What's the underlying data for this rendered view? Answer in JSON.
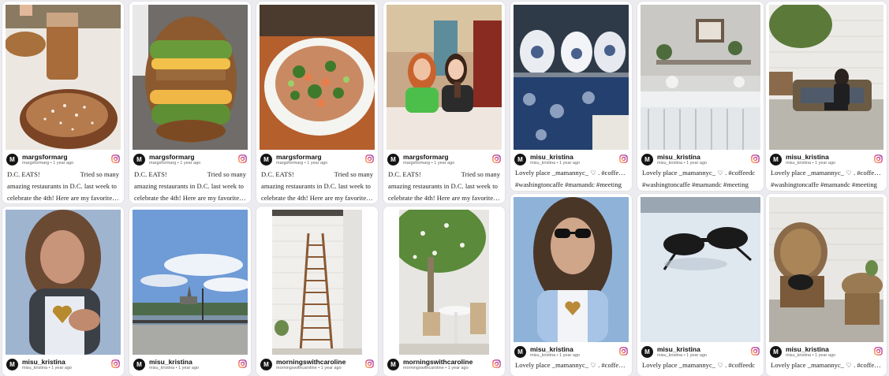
{
  "avatar_letter": "M",
  "time_ago": "1 year ago",
  "bullet": "•",
  "icons": {
    "brand": "instagram-icon",
    "avatar": "avatar-m-icon",
    "heart": "heart-icon"
  },
  "colors": {
    "instagram_gradient": [
      "#f9a23a",
      "#e1306c",
      "#833ab4"
    ],
    "avatar_bg": "#141414",
    "page_bg": "#ececf0"
  },
  "posts": [
    {
      "user": "margsformarg",
      "handle": "margsformarg",
      "caption_head": "D.C. EATS!",
      "caption_right": "Tried so many",
      "caption_line2": "amazing restaurants in D.C. last week to",
      "caption_line3": "celebrate the 4th! Here are my favorite thin..."
    },
    {
      "user": "margsformarg",
      "handle": "margsformarg",
      "caption_head": "D.C. EATS!",
      "caption_right": "Tried so many",
      "caption_line2": "amazing restaurants in D.C. last week to",
      "caption_line3": "celebrate the 4th! Here are my favorite thin..."
    },
    {
      "user": "margsformarg",
      "handle": "margsformarg",
      "caption_head": "D.C. EATS!",
      "caption_right": "Tried so many",
      "caption_line2": "amazing restaurants in D.C. last week to",
      "caption_line3": "celebrate the 4th! Here are my favorite thin..."
    },
    {
      "user": "margsformarg",
      "handle": "margsformarg",
      "caption_head": "D.C. EATS!",
      "caption_right": "Tried so many",
      "caption_line2": "amazing restaurants in D.C. last week to",
      "caption_line3": "celebrate the 4th! Here are my favorite thin..."
    },
    {
      "user": "misu_kristina",
      "handle": "misu_kristina",
      "caption_head": "Lovely place _mamannyc_ ♡ . #coffeedc",
      "caption_line2": "#washingtoncaffe #mamandc #meeting"
    },
    {
      "user": "misu_kristina",
      "handle": "misu_kristina",
      "caption_head": "Lovely place _mamannyc_ ♡ . #coffeedc",
      "caption_line2": "#washingtoncaffe #mamandc #meeting"
    },
    {
      "user": "misu_kristina",
      "handle": "misu_kristina",
      "caption_head": "Lovely place _mamannyc_ ♡ . #coffeedc",
      "caption_line2": "#washingtoncaffe #mamandc #meeting"
    },
    {
      "user": "misu_kristina",
      "handle": "misu_kristina"
    },
    {
      "user": "misu_kristina",
      "handle": "misu_kristina"
    },
    {
      "user": "morningswithcaroline",
      "handle": "morningswithcaroline"
    },
    {
      "user": "morningswithcaroline",
      "handle": "morningswithcaroline"
    },
    {
      "user": "misu_kristina",
      "handle": "misu_kristina",
      "caption_head": "Lovely place _mamannyc_ ♡ . #coffeedc"
    },
    {
      "user": "misu_kristina",
      "handle": "misu_kristina",
      "caption_head": "Lovely place _mamannyc_ ♡ . #coffeedc"
    },
    {
      "user": "misu_kristina",
      "handle": "misu_kristina",
      "caption_head": "Lovely place _mamannyc_ ♡ . #coffeedc"
    }
  ]
}
